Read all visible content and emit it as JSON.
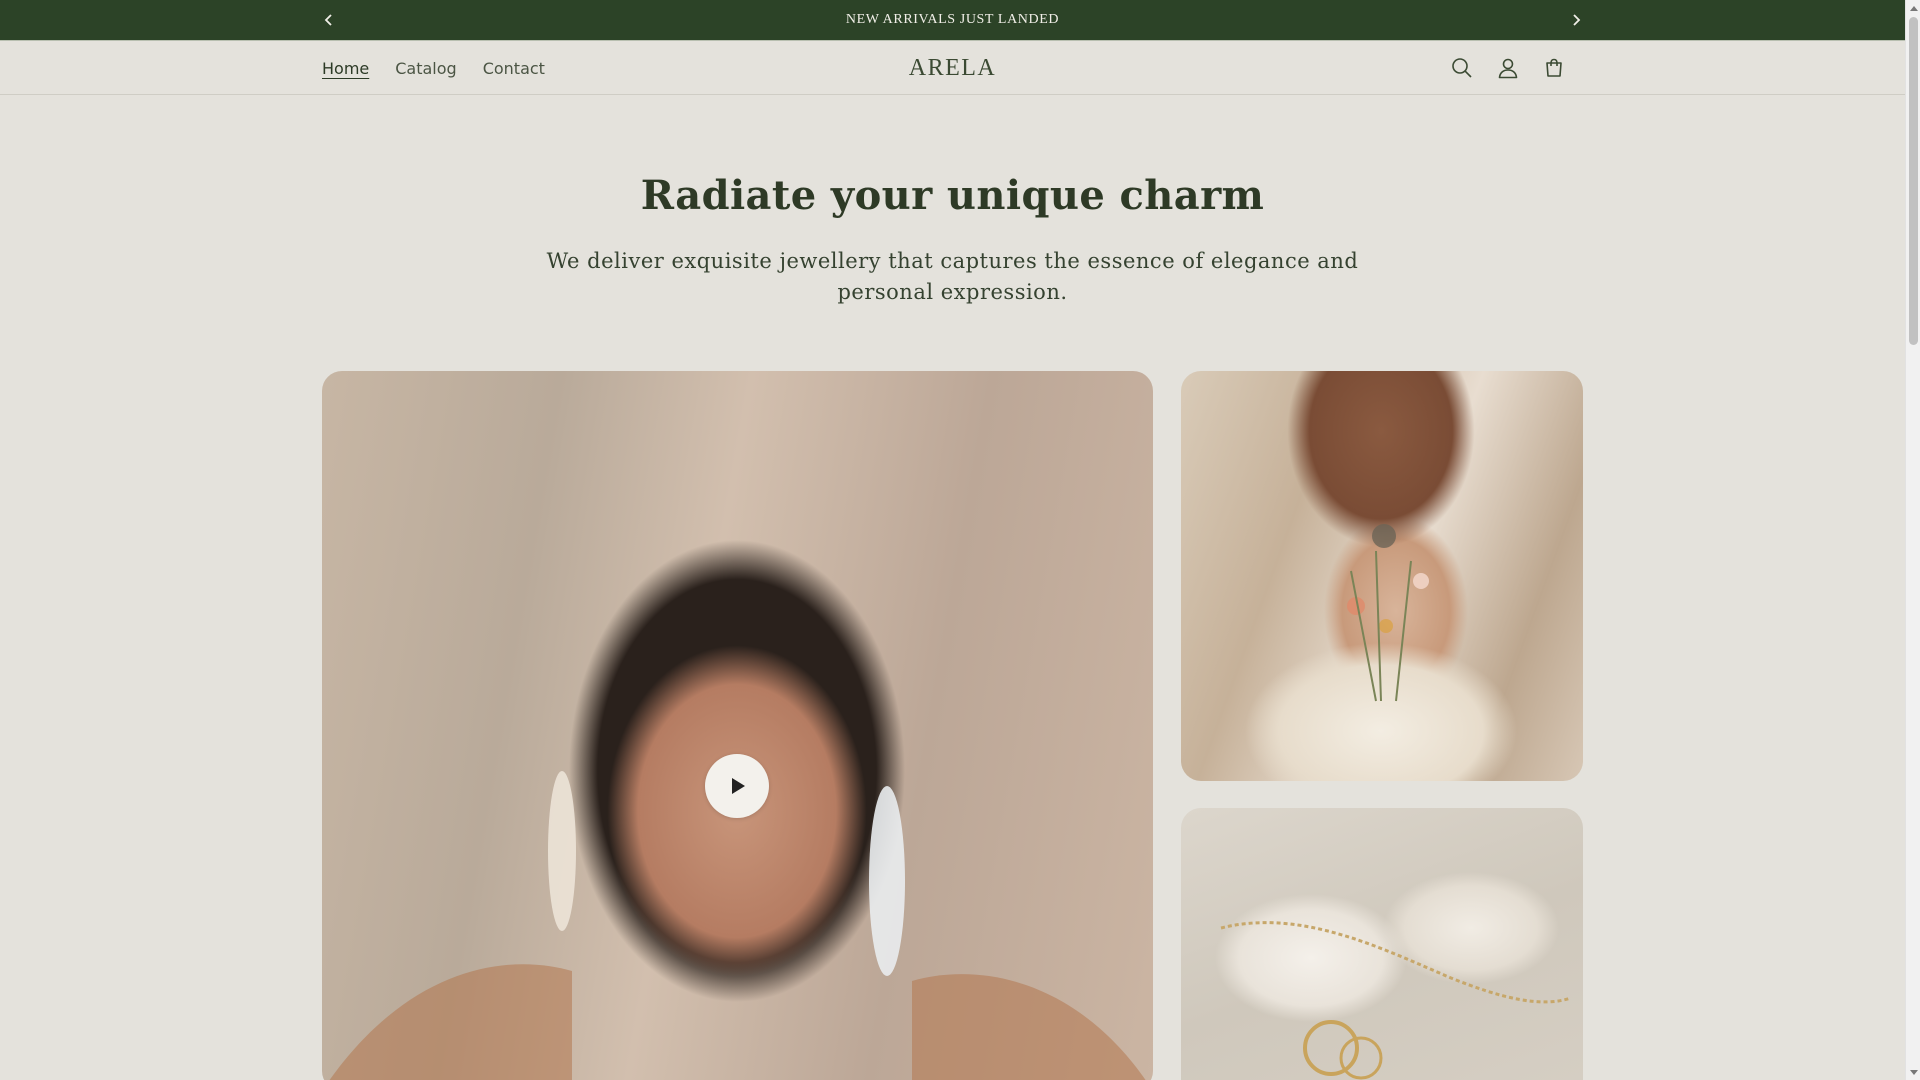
{
  "announcement": {
    "text": "NEW ARRIVALS JUST LANDED",
    "prev_icon": "chevron-left-icon",
    "next_icon": "chevron-right-icon"
  },
  "header": {
    "logo": "ARELA",
    "nav": [
      {
        "label": "Home",
        "active": true
      },
      {
        "label": "Catalog",
        "active": false
      },
      {
        "label": "Contact",
        "active": false
      }
    ],
    "icons": [
      "search-icon",
      "account-icon",
      "cart-icon"
    ]
  },
  "hero": {
    "title": "Radiate your unique charm",
    "subtitle": "We deliver exquisite jewellery that captures the essence of elegance and personal expression."
  },
  "media": {
    "main_video_icon": "play-icon",
    "images": [
      "portrait-with-hoop-earrings",
      "woman-holding-flowers-with-ring",
      "gold-chain-bracelets"
    ]
  },
  "colors": {
    "announcement_bg": "#2c4327",
    "page_bg": "#e4e2dc",
    "text": "#2e3a26"
  }
}
